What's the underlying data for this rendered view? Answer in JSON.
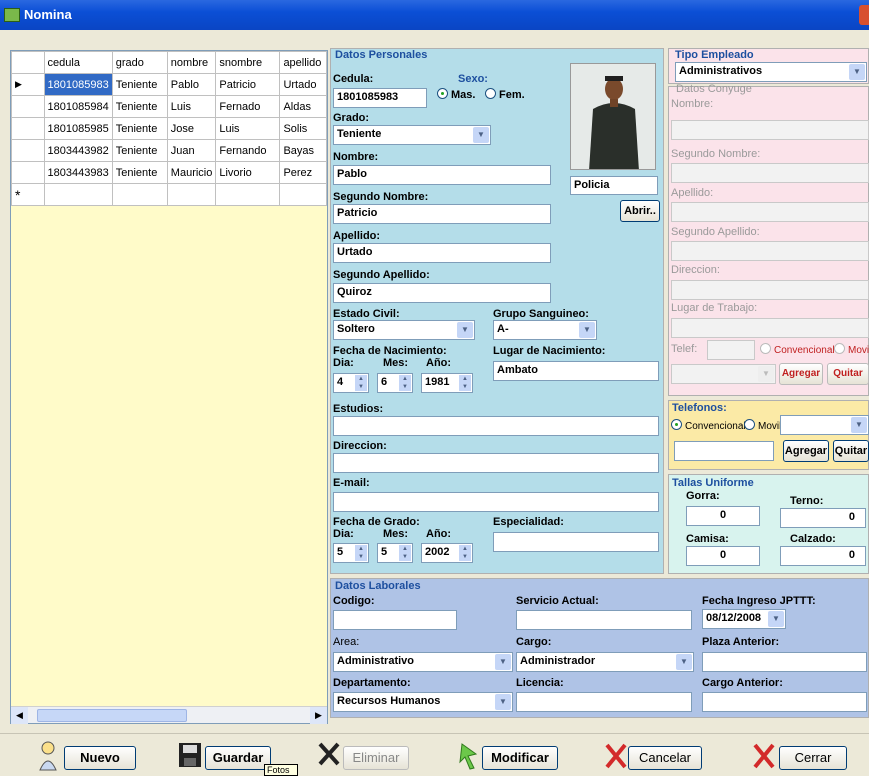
{
  "window": {
    "title": "Nomina"
  },
  "grid": {
    "columns": [
      "cedula",
      "grado",
      "nombre",
      "snombre",
      "apellido"
    ],
    "rows": [
      [
        "1801085983",
        "Teniente",
        "Pablo",
        "Patricio",
        "Urtado"
      ],
      [
        "1801085984",
        "Teniente",
        "Luis",
        "Fernado",
        "Aldas"
      ],
      [
        "1801085985",
        "Teniente",
        "Jose",
        "Luis",
        "Solis"
      ],
      [
        "1803443982",
        "Teniente",
        "Juan",
        "Fernando",
        "Bayas"
      ],
      [
        "1803443983",
        "Teniente",
        "Mauricio",
        "Livorio",
        "Perez"
      ]
    ],
    "new_row_marker": "*",
    "current_row_marker": "▶"
  },
  "personal": {
    "title": "Datos Personales",
    "cedula_label": "Cedula:",
    "cedula_value": "1801085983",
    "sexo_label": "Sexo:",
    "mas_label": "Mas.",
    "fem_label": "Fem.",
    "grado_label": "Grado:",
    "grado_value": "Teniente",
    "nombre_label": "Nombre:",
    "nombre_value": "Pablo",
    "snombre_label": "Segundo Nombre:",
    "snombre_value": "Patricio",
    "apellido_label": "Apellido:",
    "apellido_value": "Urtado",
    "sapellido_label": "Segundo Apellido:",
    "sapellido_value": "Quiroz",
    "estado_label": "Estado Civil:",
    "estado_value": "Soltero",
    "grupo_label": "Grupo Sanguineo:",
    "grupo_value": "A-",
    "fnac_label": "Fecha de Nacimiento:",
    "dia_label": "Dia:",
    "mes_label": "Mes:",
    "anio_label": "Año:",
    "fnac_dia": "4",
    "fnac_mes": "6",
    "fnac_anio": "1981",
    "lugar_label": "Lugar de Nacimiento:",
    "lugar_value": "Ambato",
    "estudios_label": "Estudios:",
    "direccion_label": "Direccion:",
    "email_label": "E-mail:",
    "fgrado_label": "Fecha de Grado:",
    "fgrado_dia": "5",
    "fgrado_mes": "5",
    "fgrado_anio": "2002",
    "especialidad_label": "Especialidad:",
    "photo_caption": "Policia",
    "abrir_label": "Abrir..",
    "tooltip": "Fotos"
  },
  "tipo": {
    "title": "Tipo Empleado",
    "value": "Administrativos"
  },
  "conyuge": {
    "title": "Datos Conyuge",
    "nombre_label": "Nombre:",
    "snombre_label": "Segundo Nombre:",
    "apellido_label": "Apellido:",
    "sapellido_label": "Segundo Apellido:",
    "direccion_label": "Direccion:",
    "trabajo_label": "Lugar de Trabajo:",
    "telef_label": "Telef:",
    "conv_label": "Convencional",
    "movil_label": "Movil",
    "agregar_label": "Agregar",
    "quitar_label": "Quitar"
  },
  "telefonos": {
    "title": "Telefonos:",
    "conv_label": "Convencional",
    "movil_label": "Movil",
    "agregar_label": "Agregar",
    "quitar_label": "Quitar"
  },
  "tallas": {
    "title": "Tallas Uniforme",
    "gorra_label": "Gorra:",
    "gorra_value": "0",
    "terno_label": "Terno:",
    "terno_value": "0",
    "camisa_label": "Camisa:",
    "camisa_value": "0",
    "calzado_label": "Calzado:",
    "calzado_value": "0"
  },
  "laborales": {
    "title": "Datos Laborales",
    "codigo_label": "Codigo:",
    "servicio_label": "Servicio Actual:",
    "fingreso_label": "Fecha Ingreso JPTTT:",
    "fingreso_value": "08/12/2008",
    "area_label": "Area:",
    "area_value": "Administrativo",
    "cargo_label": "Cargo:",
    "cargo_value": "Administrador",
    "plaza_label": "Plaza Anterior:",
    "depto_label": "Departamento:",
    "depto_value": "Recursos Humanos",
    "licencia_label": "Licencia:",
    "cargoant_label": "Cargo Anterior:"
  },
  "toolbar": {
    "nuevo": "Nuevo",
    "guardar": "Guardar",
    "eliminar": "Eliminar",
    "modificar": "Modificar",
    "cancelar": "Cancelar",
    "cerrar": "Cerrar"
  }
}
